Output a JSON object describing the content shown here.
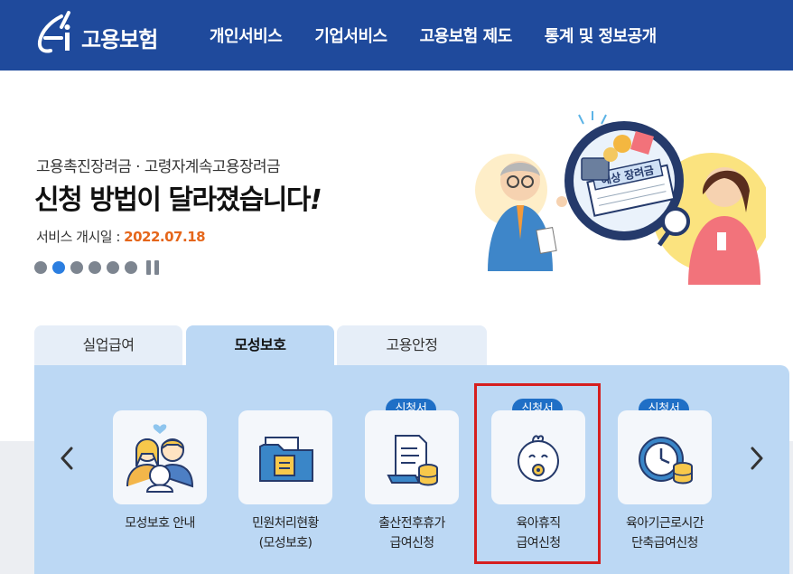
{
  "header": {
    "logo_text": "고용보험",
    "nav": [
      "개인서비스",
      "기업서비스",
      "고용보험 제도",
      "통계 및 정보공개"
    ]
  },
  "banner": {
    "subtitle": "고용촉진장려금 · 고령자계속고용장려금",
    "title": "신청 방법이 달라졌습니다",
    "title_mark": "!",
    "date_label": "서비스 개시일 : ",
    "date_value": "2022.07.18",
    "slide_count": 6,
    "active_slide": 2,
    "illustration_text": "예상 장려금"
  },
  "tabs": [
    "실업급여",
    "모성보호",
    "고용안정"
  ],
  "active_tab": "모성보호",
  "services": [
    {
      "label_1": "모성보호 안내",
      "label_2": "",
      "badge": "",
      "icon": "family-icon"
    },
    {
      "label_1": "민원처리현황",
      "label_2": "(모성보호)",
      "badge": "",
      "icon": "folder-icon"
    },
    {
      "label_1": "출산전후휴가",
      "label_2": "급여신청",
      "badge": "신청서",
      "icon": "document-coins-icon"
    },
    {
      "label_1": "육아휴직",
      "label_2": "급여신청",
      "badge": "신청서",
      "icon": "baby-icon"
    },
    {
      "label_1": "육아기근로시간",
      "label_2": "단축급여신청",
      "badge": "신청서",
      "icon": "clock-coins-icon"
    }
  ],
  "colors": {
    "header_bg": "#1f4a9c",
    "accent_date": "#e5661a",
    "panel_bg": "#bcd8f4",
    "badge_bg": "#1f6fc6",
    "highlight": "#d61f1f"
  }
}
